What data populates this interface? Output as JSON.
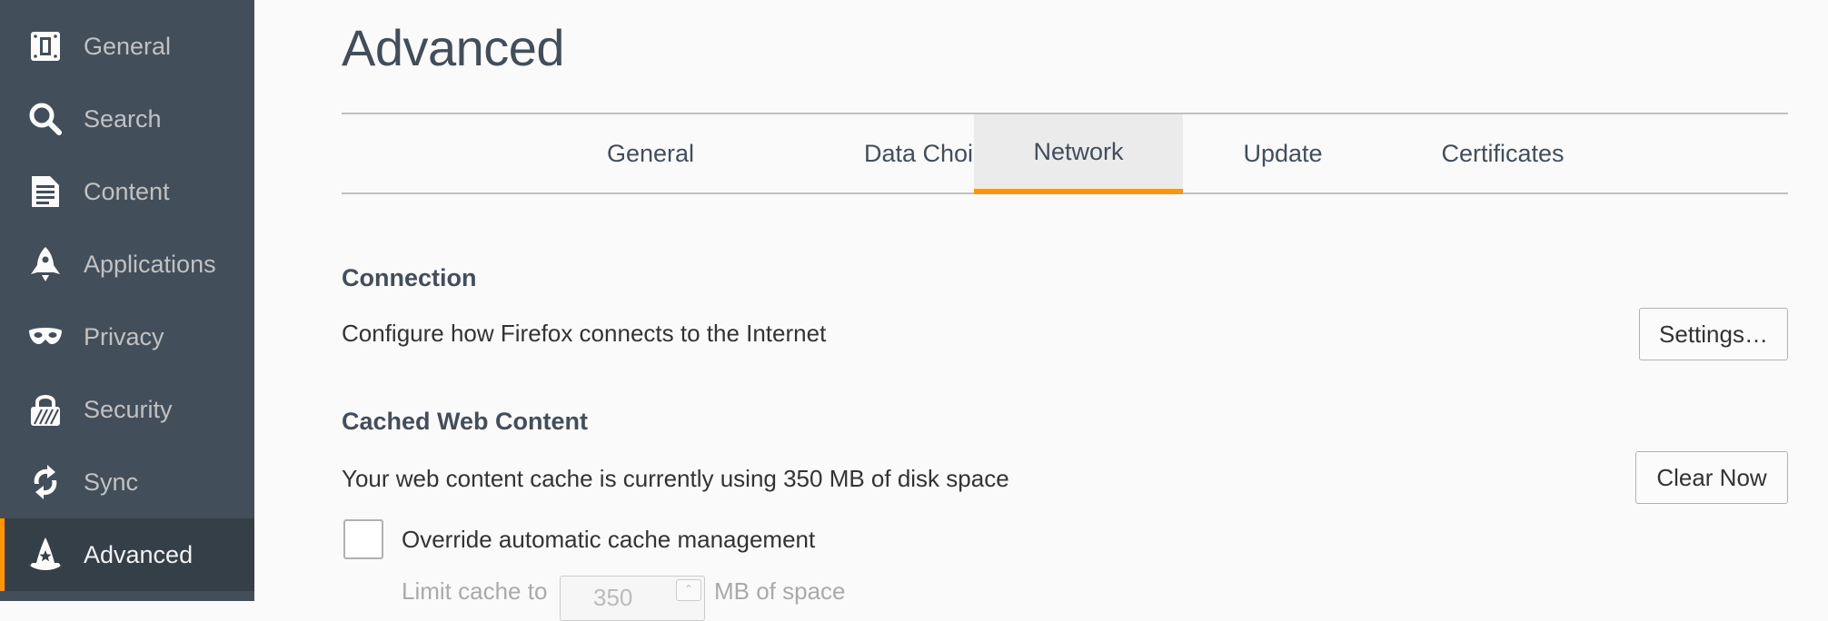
{
  "sidebar": {
    "items": [
      {
        "label": "General",
        "icon": "general-icon"
      },
      {
        "label": "Search",
        "icon": "search-icon"
      },
      {
        "label": "Content",
        "icon": "content-icon"
      },
      {
        "label": "Applications",
        "icon": "applications-icon"
      },
      {
        "label": "Privacy",
        "icon": "privacy-icon"
      },
      {
        "label": "Security",
        "icon": "security-icon"
      },
      {
        "label": "Sync",
        "icon": "sync-icon"
      },
      {
        "label": "Advanced",
        "icon": "advanced-icon",
        "active": true
      }
    ]
  },
  "page": {
    "title": "Advanced"
  },
  "tabs": [
    {
      "label": "General"
    },
    {
      "label": "Data Choices"
    },
    {
      "label": "Network",
      "active": true
    },
    {
      "label": "Update"
    },
    {
      "label": "Certificates"
    }
  ],
  "connection": {
    "heading": "Connection",
    "description": "Configure how Firefox connects to the Internet",
    "button": "Settings…"
  },
  "cache": {
    "heading": "Cached Web Content",
    "description": "Your web content cache is currently using 350 MB of disk space",
    "button": "Clear Now",
    "override_label": "Override automatic cache management",
    "override_checked": false,
    "limit_prefix": "Limit cache to",
    "limit_value": "350",
    "limit_suffix": "MB of space"
  },
  "colors": {
    "sidebar_bg": "#424f5a",
    "sidebar_active_bg": "#343f48",
    "accent": "#ff9500",
    "heading": "#424e5a"
  }
}
